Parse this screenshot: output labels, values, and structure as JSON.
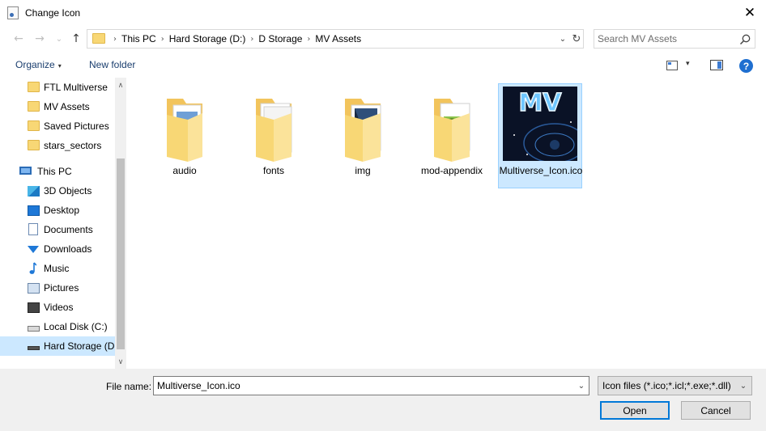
{
  "window": {
    "title": "Change Icon",
    "close_glyph": "✕"
  },
  "nav": {
    "back_glyph": "←",
    "forward_glyph": "→",
    "recent_glyph": "⌄",
    "up_glyph": "↑",
    "breadcrumbs": [
      "This PC",
      "Hard Storage (D:)",
      "D Storage",
      "MV Assets"
    ],
    "crumb_separator": "›",
    "dropdown_glyph": "⌄",
    "refresh_glyph": "↻",
    "search_placeholder": "Search MV Assets"
  },
  "toolbar": {
    "organize_label": "Organize",
    "caret_glyph": "▾",
    "new_folder_label": "New folder",
    "help_glyph": "?"
  },
  "sidebar": {
    "scroll_up_glyph": "∧",
    "scroll_down_glyph": "∨",
    "items": [
      {
        "label": "FTL Multiverse",
        "icon": "folder-icon"
      },
      {
        "label": "MV Assets",
        "icon": "folder-icon"
      },
      {
        "label": "Saved Pictures",
        "icon": "folder-icon"
      },
      {
        "label": "stars_sectors",
        "icon": "folder-icon"
      },
      {
        "label": "This PC",
        "icon": "computer-icon"
      },
      {
        "label": "3D Objects",
        "icon": "3d-objects-icon"
      },
      {
        "label": "Desktop",
        "icon": "desktop-icon"
      },
      {
        "label": "Documents",
        "icon": "documents-icon"
      },
      {
        "label": "Downloads",
        "icon": "downloads-icon"
      },
      {
        "label": "Music",
        "icon": "music-icon"
      },
      {
        "label": "Pictures",
        "icon": "pictures-icon"
      },
      {
        "label": "Videos",
        "icon": "videos-icon"
      },
      {
        "label": "Local Disk (C:)",
        "icon": "local-disk-icon"
      },
      {
        "label": "Hard Storage (D:)",
        "icon": "hard-storage-icon",
        "selected": true
      }
    ]
  },
  "files": [
    {
      "name": "audio",
      "type": "folder"
    },
    {
      "name": "fonts",
      "type": "folder"
    },
    {
      "name": "img",
      "type": "folder"
    },
    {
      "name": "mod-appendix",
      "type": "folder"
    },
    {
      "name": "Multiverse_Icon.ico",
      "type": "icon-file",
      "selected": true,
      "thumb_text": "MV"
    }
  ],
  "bottom": {
    "file_name_label": "File name:",
    "file_name_value": "Multiverse_Icon.ico",
    "filter_value": "Icon files (*.ico;*.icl;*.exe;*.dll)",
    "dropdown_glyph": "⌄",
    "open_label": "Open",
    "cancel_label": "Cancel"
  },
  "colors": {
    "selection": "#cce8ff",
    "selection_border": "#99d1ff",
    "folder": "#f8d775",
    "accent": "#0078d7",
    "link": "#1a3e6e"
  }
}
